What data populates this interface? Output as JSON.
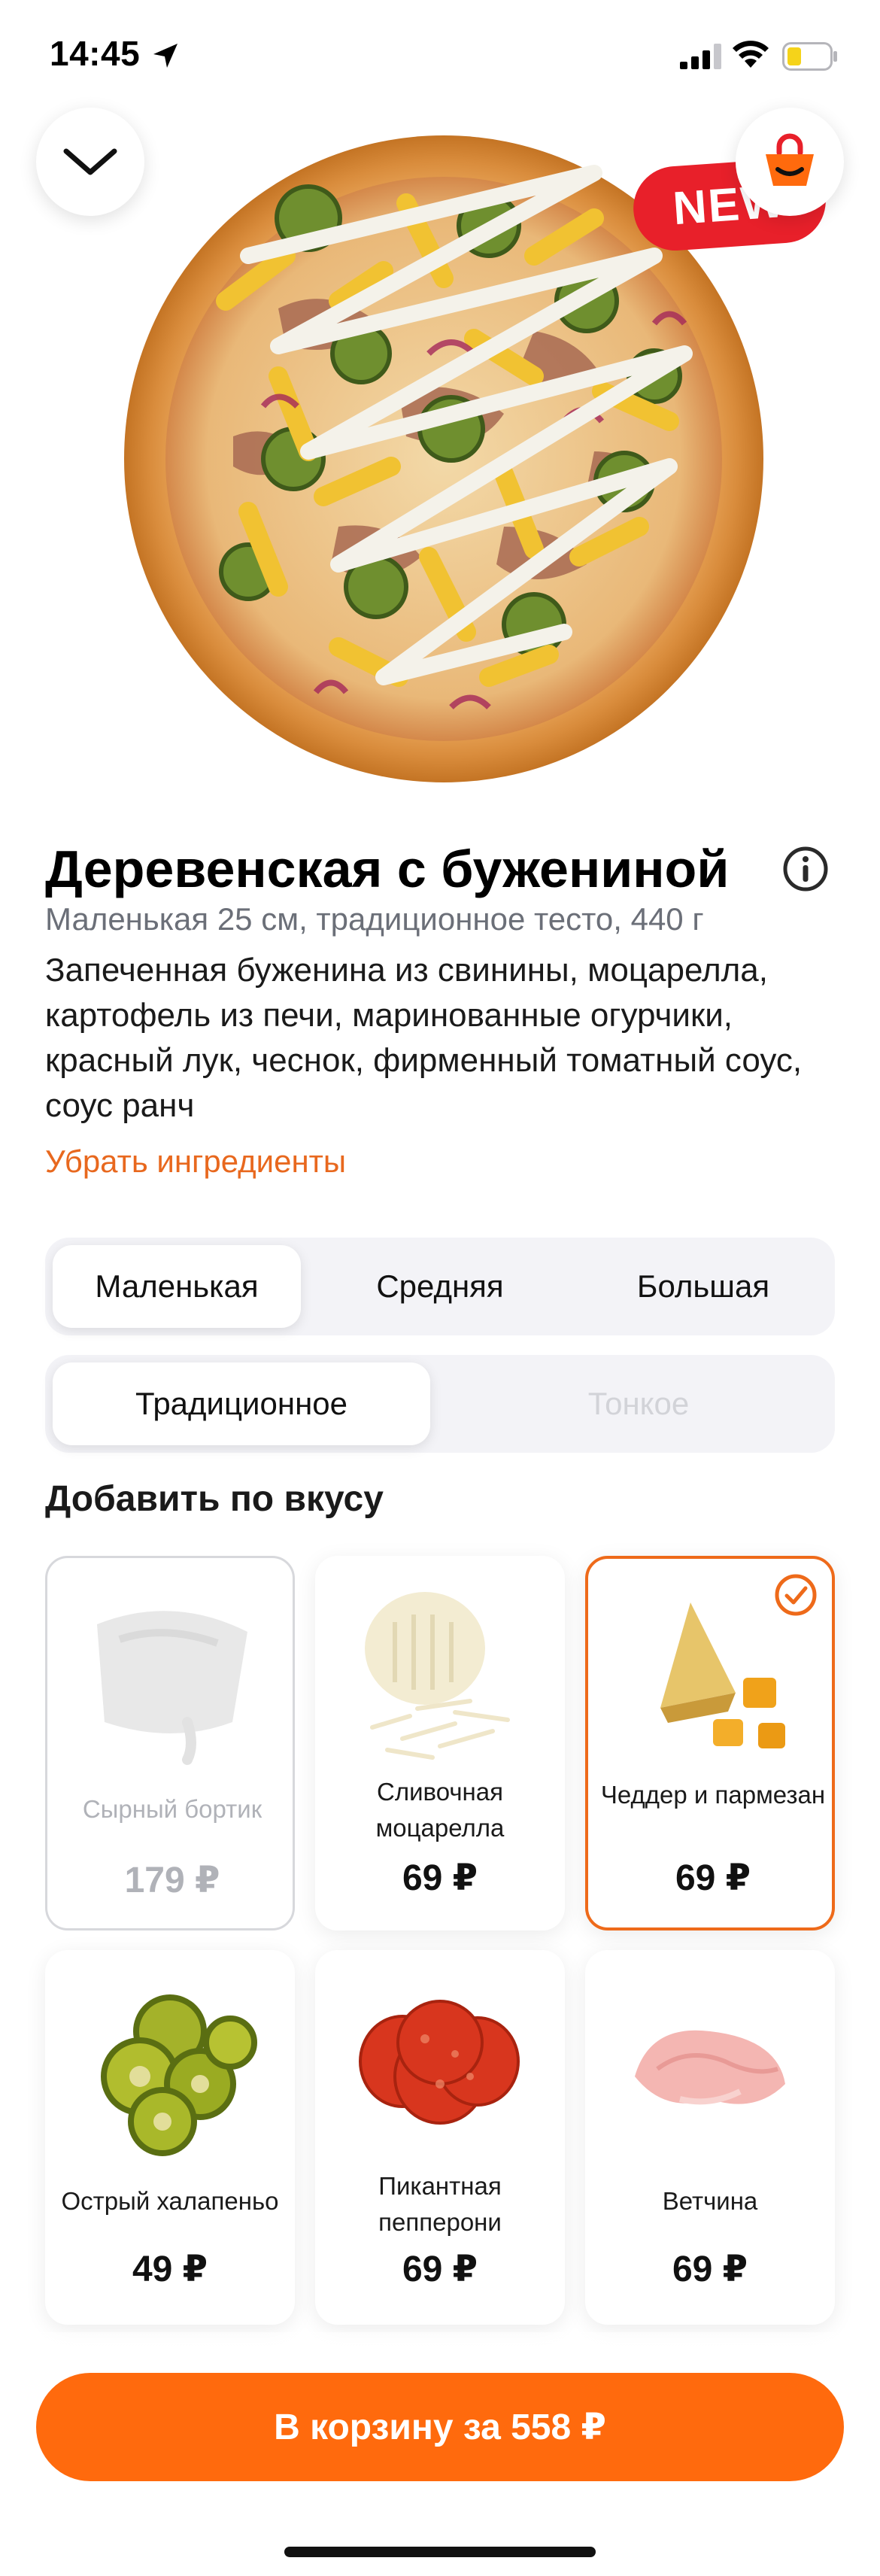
{
  "status_bar": {
    "time": "14:45",
    "icons": [
      "location-arrow-icon",
      "signal-icon",
      "wifi-icon",
      "battery-icon"
    ]
  },
  "hero": {
    "new_badge": "NEW",
    "close_icon": "chevron-down-icon",
    "cart_icon": "shopping-bag-icon"
  },
  "product": {
    "title": "Деревенская с бужениной",
    "subtitle": "Маленькая 25 см, традиционное тесто, 440 г",
    "description": "Запеченная буженина из свинины, моцарелла, картофель из печи, маринованные огурчики, красный лук, чеснок, фирменный томатный соус, соус ранч",
    "remove_ingredients": "Убрать ингредиенты"
  },
  "size_options": [
    {
      "label": "Маленькая",
      "selected": true
    },
    {
      "label": "Средняя",
      "selected": false
    },
    {
      "label": "Большая",
      "selected": false
    }
  ],
  "dough_options": [
    {
      "label": "Традиционное",
      "selected": true
    },
    {
      "label": "Тонкое",
      "selected": false,
      "disabled": true
    }
  ],
  "toppings_title": "Добавить по вкусу",
  "toppings": [
    {
      "name": "Сырный бортик",
      "price": "179 ₽",
      "state": "disabled"
    },
    {
      "name": "Сливочная моцарелла",
      "price": "69 ₽",
      "state": "normal"
    },
    {
      "name": "Чеддер и пармезан",
      "price": "69 ₽",
      "state": "selected"
    },
    {
      "name": "Острый халапеньо",
      "price": "49 ₽",
      "state": "normal"
    },
    {
      "name": "Пикантная пепперони",
      "price": "69 ₽",
      "state": "normal"
    },
    {
      "name": "Ветчина",
      "price": "69 ₽",
      "state": "normal"
    }
  ],
  "cta": {
    "label": "В корзину за 558 ₽"
  },
  "colors": {
    "accent": "#ff6a0d",
    "badge": "#e8202a",
    "link": "#e8681e",
    "muted": "#6b6f78"
  }
}
